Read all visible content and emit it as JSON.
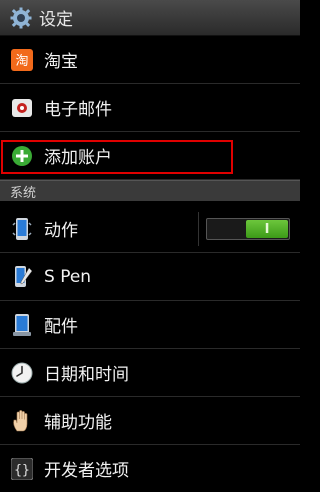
{
  "header": {
    "title": "设定",
    "icon": "gear-icon"
  },
  "accounts": [
    {
      "label": "淘宝",
      "icon": "taobao-app-icon"
    },
    {
      "label": "电子邮件",
      "icon": "email-app-icon"
    },
    {
      "label": "添加账户",
      "icon": "add-circle-icon"
    }
  ],
  "section_system": {
    "label": "系统"
  },
  "system_items": [
    {
      "label": "动作",
      "icon": "phone-motion-icon",
      "toggle": {
        "state": "on",
        "text": "I"
      }
    },
    {
      "label": "S Pen",
      "icon": "spen-icon"
    },
    {
      "label": "配件",
      "icon": "accessory-device-icon"
    },
    {
      "label": "日期和时间",
      "icon": "clock-icon"
    },
    {
      "label": "辅助功能",
      "icon": "hand-icon"
    },
    {
      "label": "开发者选项",
      "icon": "braces-icon"
    }
  ],
  "colors": {
    "highlight": "#e00000",
    "toggle_on": "#5bb52d"
  }
}
